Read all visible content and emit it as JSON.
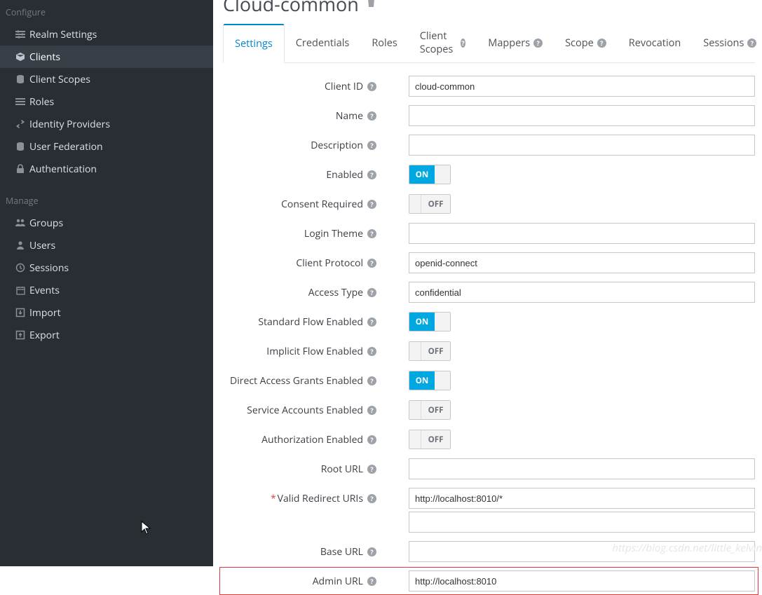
{
  "sidebar": {
    "sections": {
      "configure": {
        "title": "Configure",
        "items": [
          {
            "label": "Realm Settings",
            "icon": "sliders"
          },
          {
            "label": "Clients",
            "icon": "cube",
            "active": true
          },
          {
            "label": "Client Scopes",
            "icon": "stack"
          },
          {
            "label": "Roles",
            "icon": "list"
          },
          {
            "label": "Identity Providers",
            "icon": "exchange"
          },
          {
            "label": "User Federation",
            "icon": "database"
          },
          {
            "label": "Authentication",
            "icon": "lock"
          }
        ]
      },
      "manage": {
        "title": "Manage",
        "items": [
          {
            "label": "Groups",
            "icon": "users"
          },
          {
            "label": "Users",
            "icon": "user"
          },
          {
            "label": "Sessions",
            "icon": "clock"
          },
          {
            "label": "Events",
            "icon": "calendar"
          },
          {
            "label": "Import",
            "icon": "import"
          },
          {
            "label": "Export",
            "icon": "export"
          }
        ]
      }
    }
  },
  "page": {
    "title": "Cloud-common"
  },
  "tabs": [
    {
      "label": "Settings",
      "active": true
    },
    {
      "label": "Credentials"
    },
    {
      "label": "Roles"
    },
    {
      "label": "Client Scopes",
      "help": true
    },
    {
      "label": "Mappers",
      "help": true
    },
    {
      "label": "Scope",
      "help": true
    },
    {
      "label": "Revocation"
    },
    {
      "label": "Sessions",
      "help": true
    }
  ],
  "labels": {
    "client_id": "Client ID",
    "name": "Name",
    "description": "Description",
    "enabled": "Enabled",
    "consent_required": "Consent Required",
    "login_theme": "Login Theme",
    "client_protocol": "Client Protocol",
    "access_type": "Access Type",
    "standard_flow": "Standard Flow Enabled",
    "implicit_flow": "Implicit Flow Enabled",
    "direct_grants": "Direct Access Grants Enabled",
    "service_accounts": "Service Accounts Enabled",
    "authorization": "Authorization Enabled",
    "root_url": "Root URL",
    "redirect_uris": "Valid Redirect URIs",
    "base_url": "Base URL",
    "admin_url": "Admin URL"
  },
  "form": {
    "client_id": "cloud-common",
    "name": "",
    "description": "",
    "enabled": "ON",
    "consent_required": "OFF",
    "login_theme": "",
    "client_protocol": "openid-connect",
    "access_type": "confidential",
    "standard_flow": "ON",
    "implicit_flow": "OFF",
    "direct_grants": "ON",
    "service_accounts": "OFF",
    "authorization": "OFF",
    "root_url": "",
    "redirect_uris": "http://localhost:8010/*",
    "base_url": "",
    "admin_url": "http://localhost:8010"
  },
  "toggle_text": {
    "on": "ON",
    "off": "OFF"
  },
  "watermark": "https://blog.csdn.net/little_kelvin"
}
